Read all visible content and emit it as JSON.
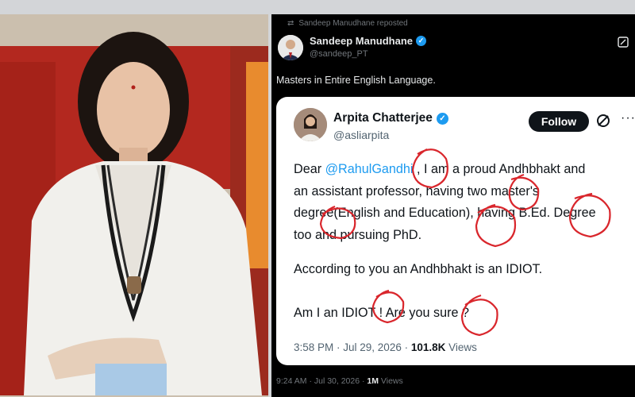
{
  "photo": {
    "subject": "woman-portrait"
  },
  "repost": {
    "label": "Sandeep Manudhane reposted",
    "name": "Sandeep Manudhane",
    "handle": "@sandeep_PT",
    "text": "Masters in Entire English Language.",
    "time": "9:24 AM · Jul 30, 2026 · ",
    "views_count": "1M",
    "views_label": " Views"
  },
  "quote": {
    "name": "Arpita Chatterjee",
    "handle": "@asliarpita",
    "follow_label": "Follow",
    "more_label": "···",
    "greeting": "Dear ",
    "mention": "@RahulGandhi",
    "body_line_1": " , I am a proud Andhbhakt and",
    "body_line_2": "an assistant professor, having two master's",
    "body_line_3": "degree(English and Education), having B.Ed. Degree",
    "body_line_4": "too and pursuing PhD.",
    "para_2": "According to you an Andhbhakt is an IDIOT.",
    "para_3": "Am I an IDIOT ! Are you sure ?",
    "time": "3:58 PM · Jul 29, 2026 · ",
    "views_count": "101.8K",
    "views_label": " Views"
  },
  "colors": {
    "verified": "#1d9bf0",
    "mention": "#1d9bf0",
    "annotation": "#d9262c",
    "panel_bg": "#000000"
  },
  "icons": [
    "repost-icon",
    "verified-icon",
    "grok-icon",
    "more-icon"
  ]
}
